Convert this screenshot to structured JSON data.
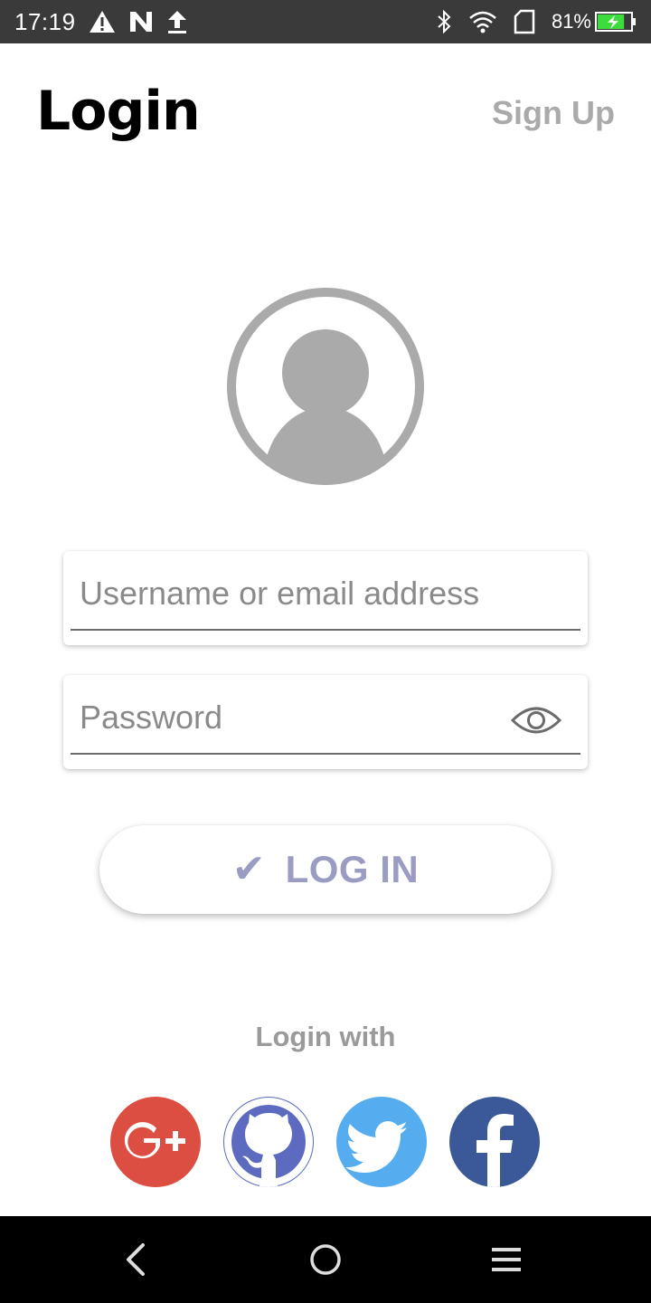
{
  "status_bar": {
    "time": "17:19",
    "battery_percent": "81%",
    "battery_level": 0.81,
    "icons": [
      "warning-icon",
      "n-notification-icon",
      "upload-icon",
      "bluetooth-icon",
      "wifi-icon",
      "sim-card-icon",
      "battery-charging-icon"
    ]
  },
  "header": {
    "title": "Login",
    "signup_label": "Sign Up"
  },
  "avatar": {
    "icon": "account-circle-icon",
    "color": "#aaaaaa"
  },
  "form": {
    "username_placeholder": "Username or email address",
    "username_value": "",
    "password_placeholder": "Password",
    "password_value": "",
    "password_toggle_icon": "eye-icon"
  },
  "login_button": {
    "label": "LOG IN",
    "icon": "✔",
    "color": "#9a9cc4"
  },
  "social": {
    "heading": "Login with",
    "providers": [
      {
        "name": "google-plus",
        "label": "G+",
        "color": "#dc4e41"
      },
      {
        "name": "github",
        "color": "#5c6bc0"
      },
      {
        "name": "twitter",
        "color": "#55acee"
      },
      {
        "name": "facebook",
        "label": "f",
        "color": "#3b5998"
      }
    ]
  },
  "nav_bar": {
    "buttons": [
      "back-icon",
      "home-icon",
      "menu-icon"
    ]
  }
}
